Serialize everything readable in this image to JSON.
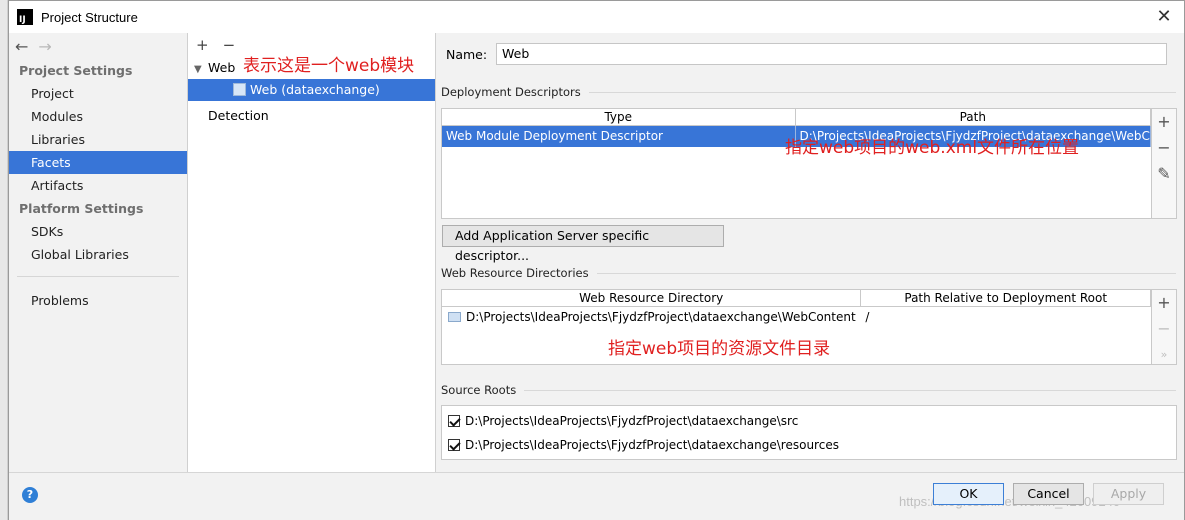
{
  "window": {
    "title": "Project Structure",
    "app_icon_text": "IJ",
    "close_glyph": "✕"
  },
  "nav": {
    "back_glyph": "←",
    "forward_glyph": "→",
    "project_settings_header": "Project Settings",
    "project_items": [
      "Project",
      "Modules",
      "Libraries",
      "Facets",
      "Artifacts"
    ],
    "selected": "Facets",
    "platform_settings_header": "Platform Settings",
    "platform_items": [
      "SDKs",
      "Global Libraries"
    ],
    "problems": "Problems"
  },
  "tree": {
    "add_glyph": "+",
    "remove_glyph": "−",
    "web_label": "Web",
    "web_annotation": "表示这是一个web模块",
    "child_label": "Web (dataexchange)",
    "detection_label": "Detection"
  },
  "form": {
    "name_label": "Name:",
    "name_value": "Web"
  },
  "deployment": {
    "section_title": "Deployment Descriptors",
    "columns": [
      "Type",
      "Path"
    ],
    "rows": [
      {
        "type": "Web Module Deployment Descriptor",
        "path": "D:\\Projects\\IdeaProjects\\FjydzfProject\\dataexchange\\WebCo"
      }
    ],
    "annotation": "指定web项目的web.xml文件所在位置",
    "tool_add": "+",
    "tool_remove": "−",
    "tool_edit": "✎",
    "add_server_button": "Add Application Server specific descriptor..."
  },
  "resources": {
    "section_title": "Web Resource Directories",
    "columns": [
      "Web Resource Directory",
      "Path Relative to Deployment Root"
    ],
    "rows": [
      {
        "directory": "D:\\Projects\\IdeaProjects\\FjydzfProject\\dataexchange\\WebContent",
        "relative": "/"
      }
    ],
    "annotation": "指定web项目的资源文件目录",
    "tool_add": "+",
    "tool_remove": "−",
    "tool_more": "»"
  },
  "source_roots": {
    "section_title": "Source Roots",
    "items": [
      "D:\\Projects\\IdeaProjects\\FjydzfProject\\dataexchange\\src",
      "D:\\Projects\\IdeaProjects\\FjydzfProject\\dataexchange\\resources"
    ]
  },
  "buttons": {
    "help": "?",
    "ok": "OK",
    "cancel": "Cancel",
    "apply": "Apply"
  },
  "watermark": "https://blog.csdn.net/weixin_42609240",
  "colors": {
    "selection": "#3875d7",
    "annotation": "#e02020",
    "help": "#2f7fd6"
  }
}
